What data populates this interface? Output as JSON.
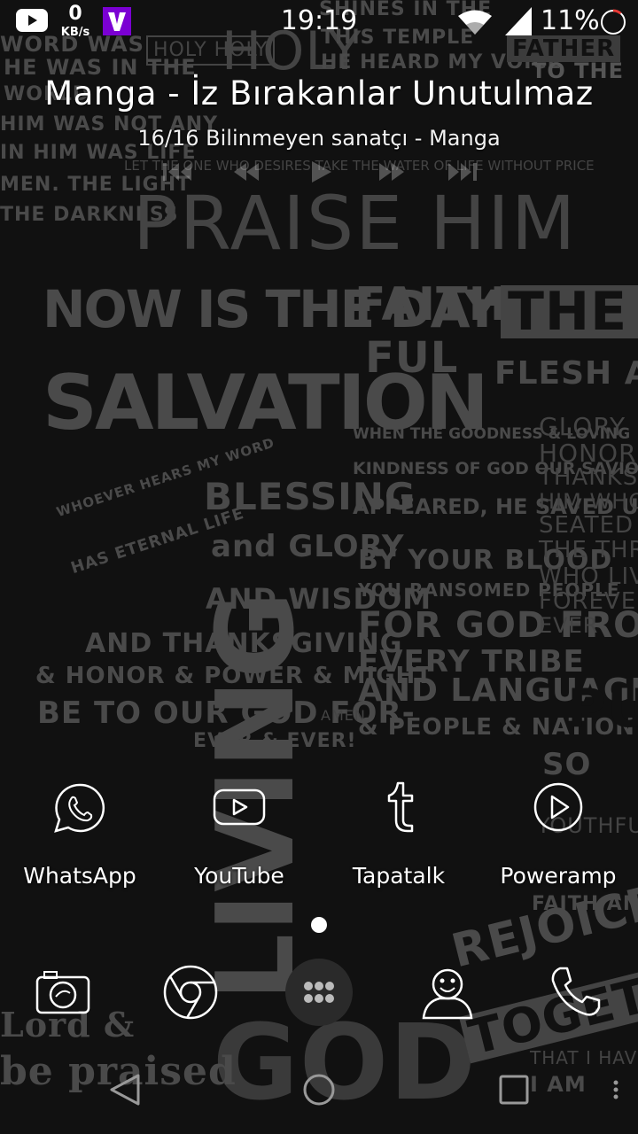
{
  "status_bar": {
    "net_speed_value": "0",
    "net_speed_unit": "KB/s",
    "time": "19:19",
    "battery_percent": "11%",
    "notification_icons": [
      "youtube-icon",
      "viber-icon"
    ],
    "system_icons": [
      "wifi-icon",
      "cell-signal-icon",
      "battery-icon"
    ]
  },
  "media": {
    "title": "Manga - İz Bırakanlar Unutulmaz",
    "subtitle": "16/16  Bilinmeyen sanatçı - Manga",
    "controls": [
      "previous-icon",
      "rewind-icon",
      "play-icon",
      "fast-forward-icon",
      "next-icon"
    ]
  },
  "wallpaper": {
    "lines": [
      "HOLY HOLY",
      "HOLY",
      "WORD WAS",
      "HE WAS IN THE",
      "WORLD",
      "HIM WAS NOT ANY",
      "IN HIM WAS LIFE",
      "MEN. THE LIGHT",
      "THE DARKNESS",
      "SHINES IN THE",
      "THIS TEMPLE",
      "HE HEARD MY VOICE",
      "FATHER",
      "TO THE",
      "LET THE ONE WHO DESIRES TAKE THE WATER OF LIFE WITHOUT PRICE",
      "PRAISE HIM",
      "NOW IS THE DAY OF",
      "SALVATION",
      "FAITH",
      "FUL",
      "THE W",
      "FLESH AND",
      "BLESSING",
      "and GLORY",
      "AND WISDOM",
      "AND THANKSGIVING",
      "& HONOR & POWER & MIGHT",
      "BE TO OUR GOD FOR-",
      "EVER & EVER!",
      "AMEN.",
      "WHEN THE GOODNESS & LOVING",
      "KINDNESS OF GOD OUR SAVIOR",
      "APPEARED, HE SAVED US",
      "BY YOUR BLOOD",
      "YOU RANSOMED PEOPLE",
      "FOR GOD FROM",
      "EVERY TRIBE",
      "AND LANGUAGE",
      "& PEOPLE & NATION",
      "GLORY",
      "HONOR",
      "THANKS",
      "HIM WHO",
      "SEATED O",
      "THE THRONE",
      "WHO LIVES",
      "FOREVER",
      "EVER",
      "WHOEVER HEARS MY WORD",
      "HAS ETERNAL LIFE",
      "LIVING",
      "GOD",
      "REJOICE",
      "TOGETHER",
      "Lord &",
      "be praised",
      "PURE",
      "SO",
      "YOUTHFUL",
      "FAITH AND",
      "THAT I HAVE",
      "I AM"
    ]
  },
  "apps": [
    {
      "label": "WhatsApp",
      "icon": "whatsapp-icon"
    },
    {
      "label": "YouTube",
      "icon": "youtube-icon"
    },
    {
      "label": "Tapatalk",
      "icon": "tapatalk-icon"
    },
    {
      "label": "Poweramp",
      "icon": "poweramp-icon"
    }
  ],
  "dock": [
    {
      "name": "camera",
      "icon": "camera-icon"
    },
    {
      "name": "chrome",
      "icon": "chrome-icon"
    },
    {
      "name": "app-drawer",
      "icon": "app-drawer-icon"
    },
    {
      "name": "contacts",
      "icon": "contacts-icon"
    },
    {
      "name": "phone",
      "icon": "phone-icon"
    }
  ],
  "page_indicator": {
    "pages": 1,
    "current": 1
  },
  "nav_bar": [
    "back-icon",
    "home-icon",
    "recents-icon",
    "menu-icon"
  ],
  "colors": {
    "foreground": "#ffffff",
    "wallpaper_ink": "#4a4a4a",
    "background": "#111111",
    "viber": "#7b00d3"
  }
}
